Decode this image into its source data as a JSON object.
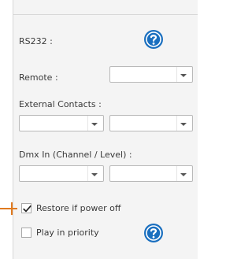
{
  "colors": {
    "help_icon": "#1a6fbf",
    "pointer": "#e07a1f",
    "panel_bg": "#f4f4f4"
  },
  "rs232": {
    "label": "RS232 :",
    "help_icon": "question-circle-icon"
  },
  "remote": {
    "label": "Remote :",
    "value": ""
  },
  "external_contacts": {
    "label": "External Contacts :",
    "select_1": "",
    "select_2": ""
  },
  "dmx_in": {
    "label": "Dmx In (Channel / Level) :",
    "channel": "",
    "level": ""
  },
  "restore_if_power_off": {
    "label": "Restore if power off",
    "checked": true
  },
  "play_in_priority": {
    "label": "Play in priority",
    "checked": false,
    "help_icon": "question-circle-icon"
  }
}
